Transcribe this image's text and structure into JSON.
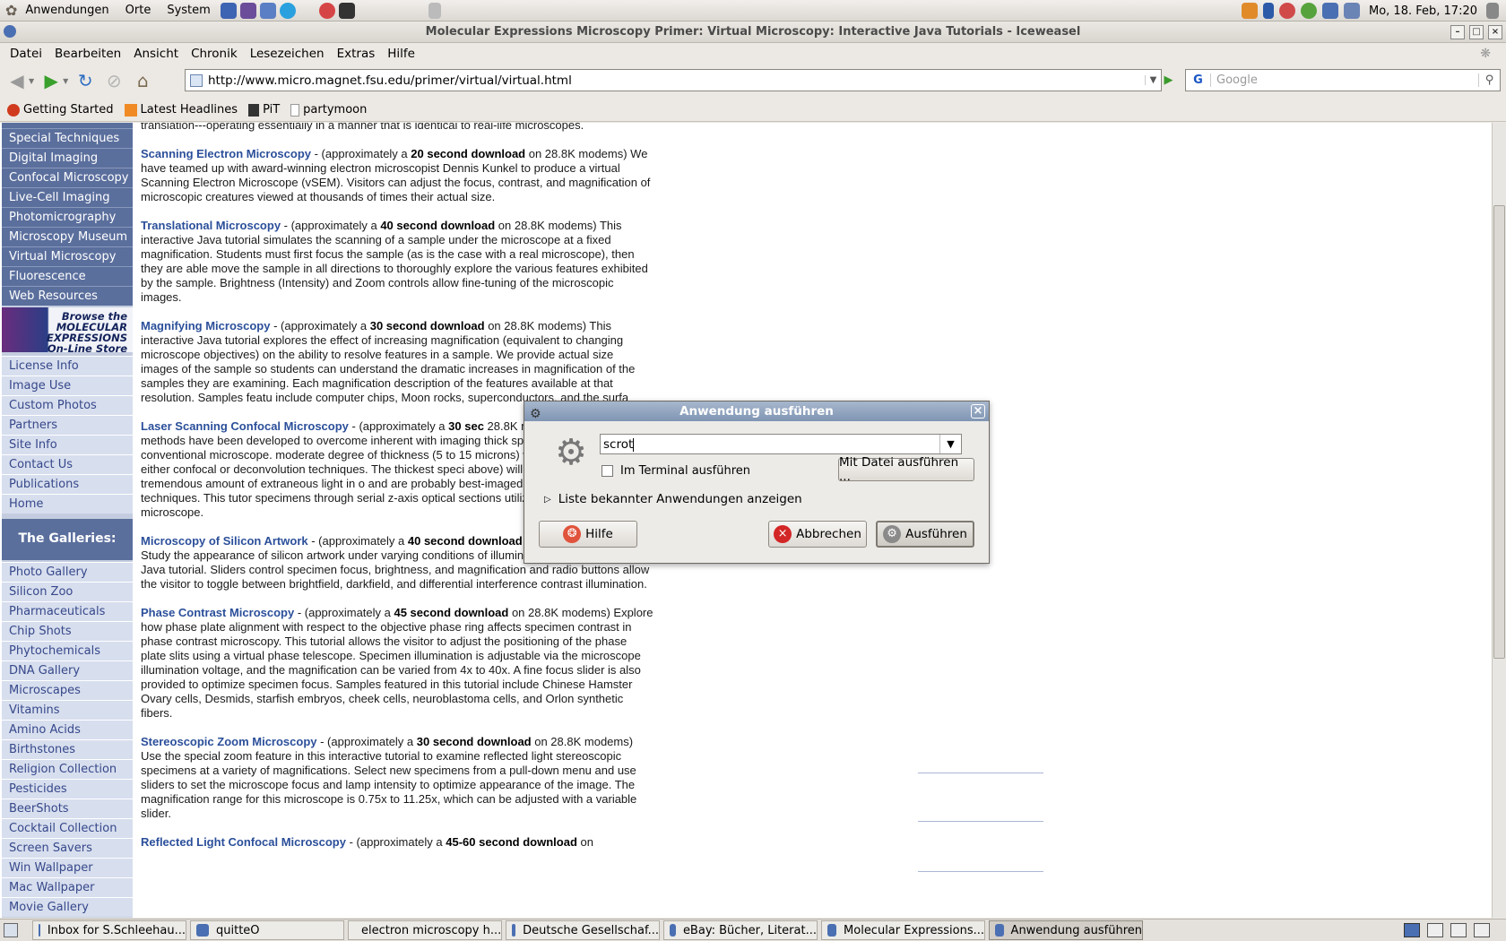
{
  "panel": {
    "menus": [
      "Anwendungen",
      "Orte",
      "System"
    ],
    "clock": "Mo, 18. Feb, 17:20"
  },
  "window": {
    "title": "Molecular Expressions Microscopy Primer: Virtual Microscopy: Interactive Java Tutorials - Iceweasel"
  },
  "menubar": [
    "Datei",
    "Bearbeiten",
    "Ansicht",
    "Chronik",
    "Lesezeichen",
    "Extras",
    "Hilfe"
  ],
  "nav": {
    "url": "http://www.micro.magnet.fsu.edu/primer/virtual/virtual.html",
    "search_placeholder": "Google",
    "search_engine_letter": "G"
  },
  "bookmarks": [
    "Getting Started",
    "Latest Headlines",
    "PiT",
    "partymoon"
  ],
  "sidebar": {
    "top_items": [
      "Special Techniques",
      "Digital Imaging",
      "Confocal Microscopy",
      "Live-Cell Imaging",
      "Photomicrography",
      "Microscopy Museum",
      "Virtual Microscopy",
      "Fluorescence",
      "Web Resources"
    ],
    "store_banner": "Browse the MOLECULAR EXPRESSIONS On-Line Store",
    "info_items": [
      "License Info",
      "Image Use",
      "Custom Photos",
      "Partners",
      "Site Info",
      "Contact Us",
      "Publications",
      "Home"
    ],
    "galleries_heading": "The Galleries:",
    "gallery_items": [
      "Photo Gallery",
      "Silicon Zoo",
      "Pharmaceuticals",
      "Chip Shots",
      "Phytochemicals",
      "DNA Gallery",
      "Microscapes",
      "Vitamins",
      "Amino Acids",
      "Birthstones",
      "Religion Collection",
      "Pesticides",
      "BeerShots",
      "Cocktail Collection",
      "Screen Savers",
      "Win Wallpaper",
      "Mac Wallpaper",
      "Movie Gallery"
    ]
  },
  "article": {
    "intro_tail": "translation---operating essentially in a manner that is identical to real-life microscopes.",
    "entries": [
      {
        "title": "Scanning Electron Microscopy",
        "pre": " - (approximately a ",
        "dl": "20 second download",
        "body": " on 28.8K modems) We have teamed up with award-winning electron microscopist Dennis Kunkel to produce a virtual Scanning Electron Microscope (vSEM). Visitors can adjust the focus, contrast, and magnification of microscopic creatures viewed at thousands of times their actual size."
      },
      {
        "title": "Translational Microscopy",
        "pre": " - (approximately a ",
        "dl": "40 second download",
        "body": " on 28.8K modems) This interactive Java tutorial simulates the scanning of a sample under the microscope at a fixed magnification. Students must first focus the sample (as is the case with a real microscope), then they are able move the sample in all directions to thoroughly explore the various features exhibited by the sample. Brightness (Intensity) and Zoom controls allow fine-tuning of the microscopic images."
      },
      {
        "title": "Magnifying Microscopy",
        "pre": " - (approximately a ",
        "dl": "30 second download",
        "body": " on 28.8K modems) This interactive Java tutorial explores the effect of increasing magnification (equivalent to changing microscope objectives) on the ability to resolve features in a sample. We provide actual size images of the sample so students can understand the dramatic increases in magnification of the samples they are examining. Each magnification description of the features available at that resolution. Samples featu include computer chips, Moon rocks, superconductors, and the surfa"
      },
      {
        "title": "Laser Scanning Confocal Microscopy",
        "pre": " - (approximately a ",
        "dl": "30 sec",
        "body": " 28.8K modems) Several methods have been developed to overcome inherent with imaging thick specimens in a conventional microscope. moderate degree of thickness (5 to 15 microns) will produce dramati with either confocal or deconvolution techniques. The thickest speci above) will suffer from a tremendous amount of extraneous light in o and are probably best-imaged using confocal techniques. This tutor specimens through serial z-axis optical sections utilizing a virtual confocal microscope."
      },
      {
        "title": "Microscopy of Silicon Artwork",
        "pre": " - (approximately a ",
        "dl": "40 second download",
        "body": " on 28.8K modems) Study the appearance of silicon artwork under varying conditions of illumination with this interactive Java tutorial. Sliders control specimen focus, brightness, and magnification and radio buttons allow the visitor to toggle between brightfield, darkfield, and differential interference contrast illumination."
      },
      {
        "title": "Phase Contrast Microscopy",
        "pre": " - (approximately a ",
        "dl": "45 second download",
        "body": " on 28.8K modems) Explore how phase plate alignment with respect to the objective phase ring affects specimen contrast in phase contrast microscopy. This tutorial allows the visitor to adjust the positioning of the phase plate slits using a virtual phase telescope. Specimen illumination is adjustable via the microscope illumination voltage, and the magnification can be varied from 4x to 40x. A fine focus slider is also provided to optimize specimen focus. Samples featured in this tutorial include Chinese Hamster Ovary cells, Desmids, starfish embryos, cheek cells, neuroblastoma cells, and Orlon synthetic fibers."
      },
      {
        "title": "Stereoscopic Zoom Microscopy",
        "pre": " - (approximately a ",
        "dl": "30 second download",
        "body": " on 28.8K modems) Use the special zoom feature in this interactive tutorial to examine reflected light stereoscopic specimens at a variety of magnifications. Select new specimens from a pull-down menu and use sliders to set the microscope focus and lamp intensity to optimize appearance of the image. The magnification range for this microscope is 0.75x to 11.25x, which can be adjusted with a variable slider."
      },
      {
        "title": "Reflected Light Confocal Microscopy",
        "pre": " - (approximately a ",
        "dl": "45-60 second download",
        "body": " on"
      }
    ]
  },
  "dialog": {
    "title": "Anwendung ausführen",
    "command_value": "scrot",
    "terminal_label": "Im Terminal ausführen",
    "file_button": "Mit Datei ausführen ...",
    "expander_label": "Liste bekannter Anwendungen anzeigen",
    "help_button": "Hilfe",
    "cancel_button": "Abbrechen",
    "run_button": "Ausführen"
  },
  "taskbar": [
    {
      "label": "Inbox for S.Schleehau...",
      "active": false
    },
    {
      "label": "quitteO",
      "active": false
    },
    {
      "label": "electron microscopy h...",
      "active": false
    },
    {
      "label": "Deutsche Gesellschaf...",
      "active": false
    },
    {
      "label": "eBay: Bücher, Literat...",
      "active": false
    },
    {
      "label": "Molecular Expressions...",
      "active": false
    },
    {
      "label": "Anwendung ausführen",
      "active": true
    }
  ],
  "colors": {
    "sidebar_dark": "#5b6f9d",
    "sidebar_light": "#d7deee",
    "link_title": "#2b4f9a",
    "dialog_titlebar": "#8ea2bf"
  }
}
